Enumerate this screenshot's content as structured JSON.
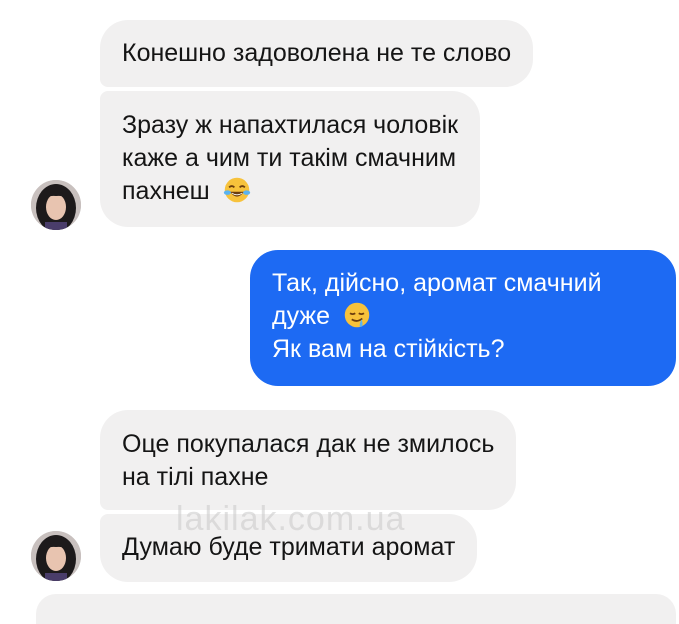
{
  "conversation": {
    "messages": [
      {
        "sender": "contact",
        "lines": [
          "Конешно задоволена не те слово"
        ]
      },
      {
        "sender": "contact",
        "lines": [
          "Зразу ж напахтилася чоловік",
          "каже а чим ти такім смачним",
          "пахнеш"
        ],
        "emoji": "face-with-tears-of-joy"
      },
      {
        "sender": "me",
        "lines": [
          "Так, дійсно, аромат смачний",
          "дуже",
          "Як вам на стійкість?"
        ],
        "emoji": "drooling-face"
      },
      {
        "sender": "contact",
        "lines": [
          "Оце покупалася дак не змилось",
          "на тілі пахне"
        ]
      },
      {
        "sender": "contact",
        "lines": [
          "Думаю буде тримати аромат"
        ]
      }
    ]
  },
  "watermark": "lakilak.com.ua",
  "colors": {
    "incoming_bubble": "#f1f0f0",
    "outgoing_bubble": "#1d6af3",
    "incoming_text": "#151515",
    "outgoing_text": "#ffffff"
  }
}
